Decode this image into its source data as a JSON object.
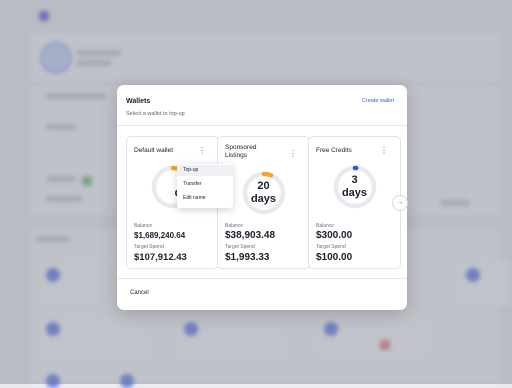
{
  "modal": {
    "title": "Wallets",
    "subtitle": "Select a wallet to top-up",
    "create_wallet_label": "Create wallet",
    "cancel_label": "Cancel"
  },
  "wallets": [
    {
      "name": "Default wallet",
      "days_label_partial": "1",
      "days_label_partial2": "da",
      "balance_label": "Balance",
      "balance": "$1,689,240.64",
      "target_label": "Target Spend",
      "target": "$107,912.43",
      "ring_fraction": 0.3,
      "ring_color": "#f5a524"
    },
    {
      "name": "Sponsored Listings",
      "days_number": "20",
      "days_unit": "days",
      "balance_label": "Balance",
      "balance": "$38,903.48",
      "target_label": "Target Spend",
      "target": "$1,993.33",
      "ring_fraction": 0.06,
      "ring_color": "#f5a524"
    },
    {
      "name": "Free Credits",
      "days_number": "3",
      "days_unit": "days",
      "balance_label": "Balance",
      "balance": "$300.00",
      "target_label": "Target Spend",
      "target": "$100.00",
      "ring_fraction": 0.01,
      "ring_color": "#2f54eb"
    }
  ],
  "context_menu": {
    "items": [
      "Top-up",
      "Transfer",
      "Edit name"
    ]
  },
  "icons": {
    "kebab": "more-vertical-icon",
    "next": "arrow-right-icon"
  },
  "colors": {
    "accent": "#3b5bdb",
    "ring_track": "#e9eaee",
    "warning": "#f5a524"
  }
}
